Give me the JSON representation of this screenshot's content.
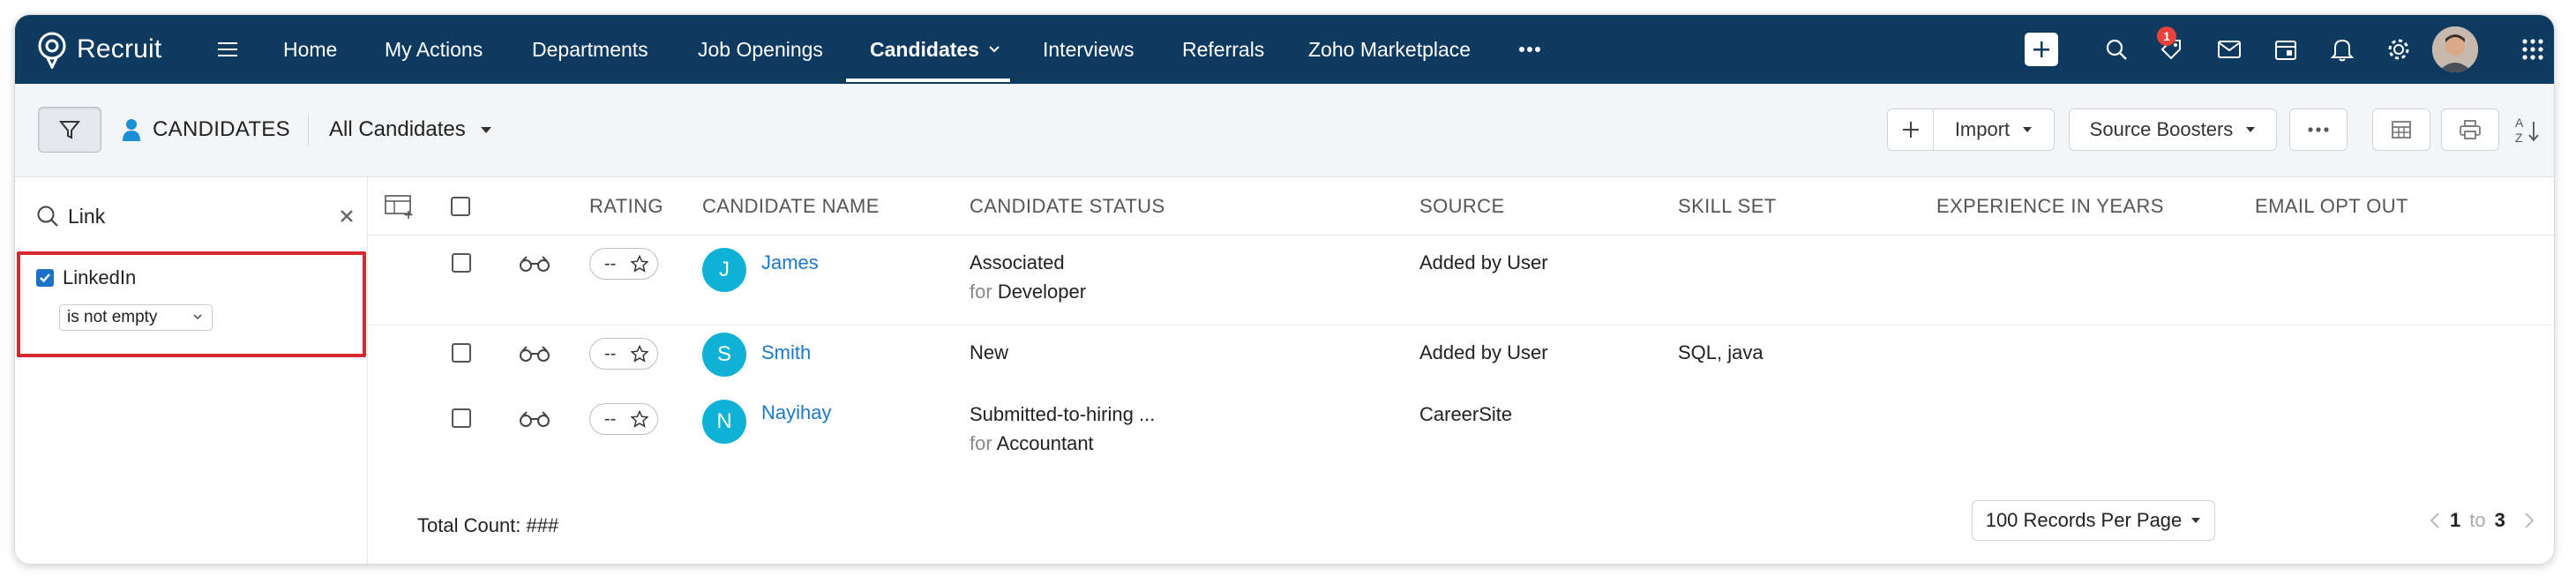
{
  "brand": {
    "name": "Recruit"
  },
  "nav": {
    "items": [
      {
        "label": "Home"
      },
      {
        "label": "My Actions"
      },
      {
        "label": "Departments"
      },
      {
        "label": "Job Openings"
      },
      {
        "label": "Candidates",
        "active": true
      },
      {
        "label": "Interviews"
      },
      {
        "label": "Referrals"
      },
      {
        "label": "Zoho Marketplace"
      }
    ],
    "more_icon": "ellipsis-icon",
    "notification_badge": "1",
    "right_icons": [
      "plus-icon",
      "search-icon",
      "tag-icon",
      "mail-icon",
      "calendar-icon",
      "bell-icon",
      "gear-icon",
      "avatar",
      "apps-grid-icon"
    ]
  },
  "toolbar": {
    "module_title": "CANDIDATES",
    "view": "All Candidates",
    "import_label": "Import",
    "boosters_label": "Source Boosters"
  },
  "filter": {
    "search_value": "Link",
    "field_label": "LinkedIn",
    "field_checked": true,
    "condition": "is not empty"
  },
  "table": {
    "columns": {
      "rating": "RATING",
      "name": "CANDIDATE NAME",
      "status": "CANDIDATE STATUS",
      "source": "SOURCE",
      "skills": "SKILL SET",
      "experience": "EXPERIENCE IN YEARS",
      "email_opt_out": "EMAIL OPT OUT"
    },
    "rating_placeholder": "--",
    "for_label": "for",
    "rows": [
      {
        "initial": "J",
        "name": "James",
        "status": "Associated",
        "status_for": "Developer",
        "source": "Added by User",
        "skills": ""
      },
      {
        "initial": "S",
        "name": "Smith",
        "status": "New",
        "status_for": "",
        "source": "Added by User",
        "skills": "SQL, java"
      },
      {
        "initial": "N",
        "name": "Nayihay",
        "status": "Submitted-to-hiring ...",
        "status_for": "Accountant",
        "source": "CareerSite",
        "skills": ""
      }
    ]
  },
  "footer": {
    "total_count": "Total Count: ###",
    "per_page": "100 Records Per Page",
    "page_from": "1",
    "page_to_word": "to",
    "page_to": "3"
  },
  "colors": {
    "nav_bg": "#0f3a60",
    "accent": "#1b78c9",
    "avatar_initial_bg": "#0fb1d4",
    "highlight": "#d9272e"
  }
}
